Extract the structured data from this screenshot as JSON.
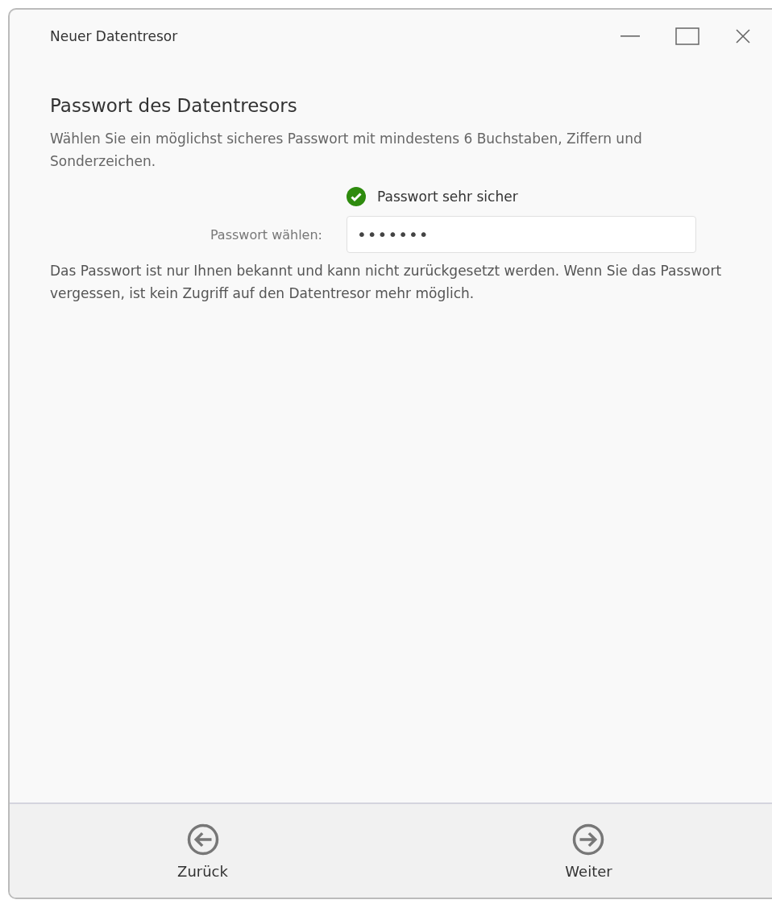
{
  "window": {
    "title": "Neuer Datentresor"
  },
  "heading": "Passwort des Datentresors",
  "description": "Wählen Sie ein möglichst sicheres Passwort mit mindestens 6 Buchstaben, Ziffern und Sonderzeichen.",
  "strength": {
    "ok": true,
    "text": "Passwort sehr sicher"
  },
  "password": {
    "label": "Passwort wählen:",
    "value": "•••••••"
  },
  "note": "Das Passwort ist nur Ihnen bekannt und kann nicht zurückgesetzt werden. Wenn Sie das Passwort vergessen, ist kein Zugriff auf den Datentresor mehr möglich.",
  "footer": [
    {
      "kind": "back",
      "label": "Zurück"
    },
    {
      "kind": "next",
      "label": "Weiter"
    }
  ]
}
